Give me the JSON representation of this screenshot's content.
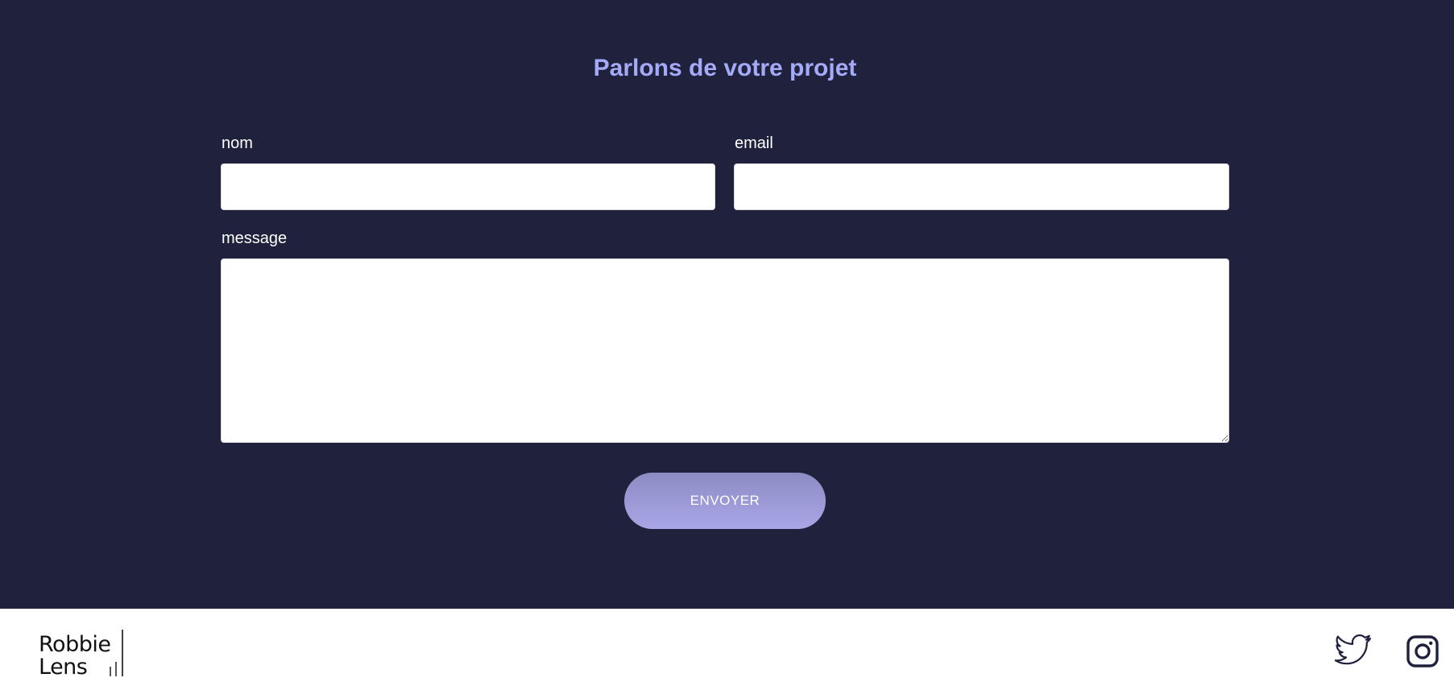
{
  "contact": {
    "title": "Parlons de votre projet",
    "name_label": "nom",
    "name_value": "",
    "email_label": "email",
    "email_value": "",
    "message_label": "message",
    "message_value": "",
    "submit_label": "ENVOYER"
  },
  "footer": {
    "logo_line1": "Robbie",
    "logo_line2": "Lens",
    "social_icons": [
      "twitter-icon",
      "instagram-icon"
    ]
  },
  "colors": {
    "section_background": "#20213c",
    "title_accent": "#a4aaf7",
    "button_gradient_top": "#8c8cc4",
    "button_gradient_bottom": "#a9a6e6",
    "footer_background": "#ffffff",
    "icon_color": "#20213c"
  }
}
